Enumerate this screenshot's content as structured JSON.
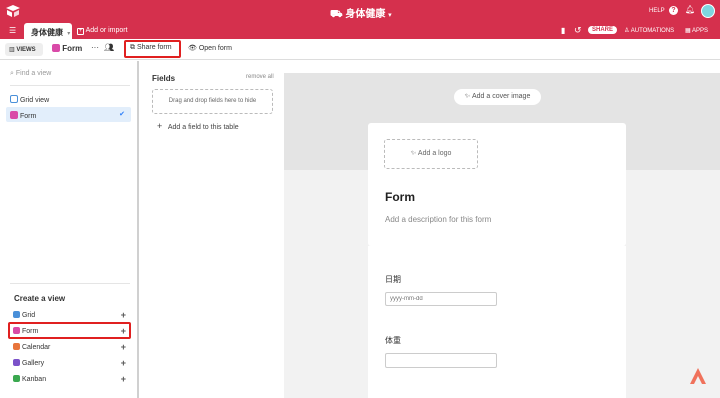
{
  "header": {
    "base_title": "身体健康",
    "help": "HELP",
    "share": "SHARE",
    "automations": "AUTOMATIONS",
    "apps": "APPS"
  },
  "tabs": {
    "active_table": "身体健康",
    "add_or_import": "Add or import"
  },
  "viewbar": {
    "views_label": "VIEWS",
    "current_view": "Form",
    "share_form": "Share form",
    "open_form": "Open form"
  },
  "sidebar": {
    "search_placeholder": "Find a view",
    "views": [
      {
        "label": "Grid view",
        "icon": "grid-icon"
      },
      {
        "label": "Form",
        "icon": "form-icon",
        "selected": true
      }
    ],
    "create_title": "Create a view",
    "create_items": [
      {
        "label": "Grid",
        "color": "#4a90d9"
      },
      {
        "label": "Form",
        "color": "#d94aa8"
      },
      {
        "label": "Calendar",
        "color": "#e8743b"
      },
      {
        "label": "Gallery",
        "color": "#7b52c9"
      },
      {
        "label": "Kanban",
        "color": "#3aa84f"
      }
    ]
  },
  "fields_panel": {
    "title": "Fields",
    "remove_all": "remove all",
    "drop_hint": "Drag and drop fields here to hide",
    "add_field": "Add a field to this table"
  },
  "form": {
    "add_cover": "Add a cover image",
    "add_logo": "Add a logo",
    "title": "Form",
    "description_placeholder": "Add a description for this form",
    "fields": [
      {
        "label": "日期",
        "placeholder": "yyyy-mm-dd"
      },
      {
        "label": "体重",
        "placeholder": ""
      }
    ]
  },
  "colors": {
    "brand": "#d5304d",
    "highlight": "#e02020"
  }
}
